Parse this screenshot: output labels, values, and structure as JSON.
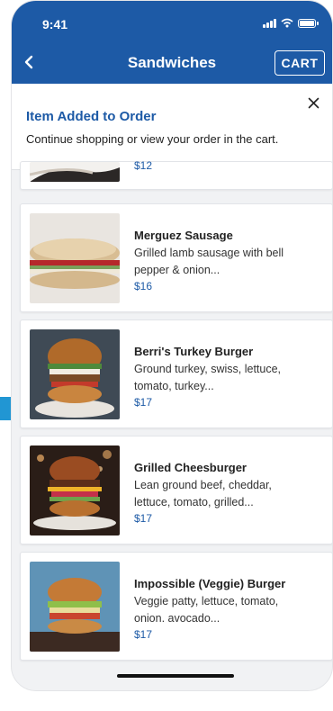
{
  "status_bar": {
    "time": "9:41"
  },
  "header": {
    "title": "Sandwiches",
    "cart_label": "CART"
  },
  "banner": {
    "title": "Item Added to Order",
    "message": "Continue shopping or view your order in the cart."
  },
  "partial_item": {
    "price": "$12"
  },
  "items": [
    {
      "name": "Merguez Sausage",
      "desc_line1": "Grilled lamb sausage with bell",
      "desc_line2": "pepper & onion...",
      "price": "$16"
    },
    {
      "name": "Berri's Turkey Burger",
      "desc_line1": "Ground turkey, swiss, lettuce,",
      "desc_line2": "tomato, turkey...",
      "price": "$17"
    },
    {
      "name": "Grilled Cheesburger",
      "desc_line1": "Lean ground beef, cheddar,",
      "desc_line2": "lettuce, tomato, grilled...",
      "price": "$17"
    },
    {
      "name": "Impossible (Veggie) Burger",
      "desc_line1": "Veggie patty, lettuce, tomato,",
      "desc_line2": "onion. avocado...",
      "price": "$17"
    }
  ],
  "colors": {
    "brand": "#1d5aa6",
    "accent_tab": "#2196d3"
  }
}
